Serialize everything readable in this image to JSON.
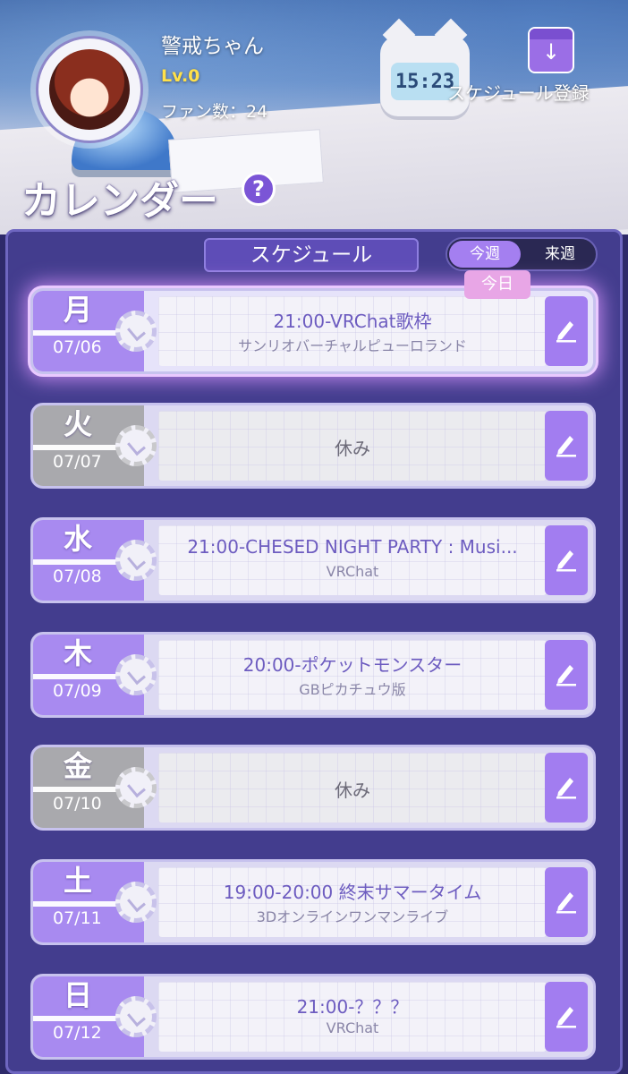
{
  "profile": {
    "name": "警戒ちゃん",
    "level": "Lv.0",
    "fans": "ファン数：24"
  },
  "page": {
    "title": "カレンダー",
    "help_icon": "?",
    "register_label": "スケジュール登録",
    "clock_display": "15:23"
  },
  "schedule": {
    "header": "スケジュール",
    "tabs": [
      "今週",
      "来週"
    ],
    "today_badge": "今日",
    "days": [
      {
        "kanji": "月",
        "date": "07/06",
        "title": "21:00-VRChat歌枠",
        "sub": "サンリオバーチャルピューロランド",
        "off": false,
        "today": true
      },
      {
        "kanji": "火",
        "date": "07/07",
        "title": "休み",
        "sub": "",
        "off": true,
        "today": false
      },
      {
        "kanji": "水",
        "date": "07/08",
        "title": "21:00-CHESED NIGHT PARTY : Musi...",
        "sub": "VRChat",
        "off": false,
        "today": false
      },
      {
        "kanji": "木",
        "date": "07/09",
        "title": "20:00-ポケットモンスター",
        "sub": "GBピカチュウ版",
        "off": false,
        "today": false
      },
      {
        "kanji": "金",
        "date": "07/10",
        "title": "休み",
        "sub": "",
        "off": true,
        "today": false
      },
      {
        "kanji": "土",
        "date": "07/11",
        "title": "19:00-20:00 終末サマータイム",
        "sub": "3Dオンラインワンマンライブ",
        "off": false,
        "today": false
      },
      {
        "kanji": "日",
        "date": "07/12",
        "title": "21:00-？？？",
        "sub": "VRChat",
        "off": false,
        "today": false
      }
    ]
  },
  "colors": {
    "accent": "#a27df0",
    "panel": "#433d8e",
    "off_gray": "#a9a9ad"
  }
}
